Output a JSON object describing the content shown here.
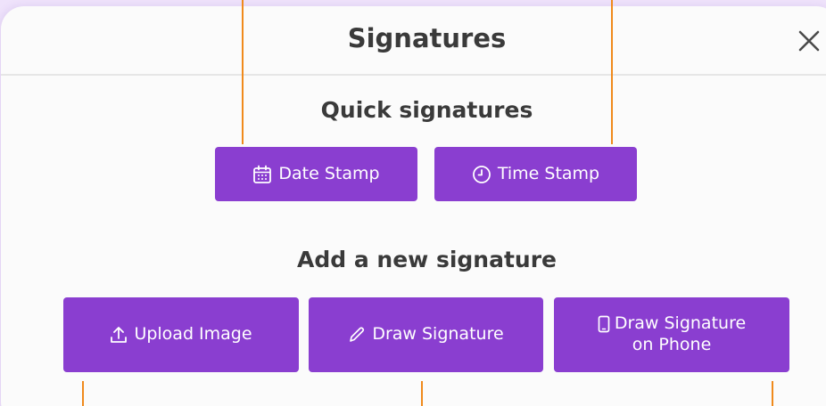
{
  "modal": {
    "title": "Signatures",
    "close_icon": "close-icon"
  },
  "quick": {
    "heading": "Quick signatures",
    "buttons": [
      {
        "label": "Date Stamp",
        "icon": "calendar-icon"
      },
      {
        "label": "Time Stamp",
        "icon": "clock-icon"
      }
    ]
  },
  "add": {
    "heading": "Add a new signature",
    "buttons": [
      {
        "label": "Upload Image",
        "icon": "upload-icon"
      },
      {
        "label": "Draw Signature",
        "icon": "pen-icon"
      },
      {
        "label_line1": "Draw Signature",
        "label_line2": "on Phone",
        "icon": "phone-icon"
      }
    ]
  },
  "colors": {
    "button": "#8a3ed0",
    "guide": "#f08a1c",
    "background": "#efe3fb"
  }
}
